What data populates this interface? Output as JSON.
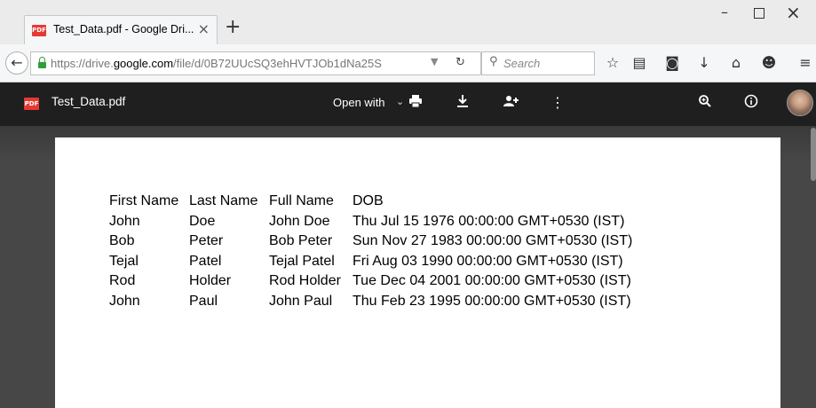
{
  "browser": {
    "tab": {
      "title": "Test_Data.pdf - Google Dri...",
      "icon": "pdf-icon",
      "close": "×"
    },
    "new_tab": "+",
    "window_controls": {
      "minimize": "–",
      "maximize": "□",
      "close": "×"
    },
    "url": {
      "prefix": "https://drive.",
      "domain": "google.com",
      "path": "/file/d/0B72UUcSQ3ehHVTJOb1dNa25S"
    },
    "search": {
      "placeholder": "Search"
    },
    "toolbar_icons": [
      "star-icon",
      "reading-list-icon",
      "pocket-icon",
      "download-icon",
      "home-icon",
      "chat-icon",
      "menu-icon"
    ]
  },
  "drive": {
    "file_name": "Test_Data.pdf",
    "open_with": "Open with",
    "pdf_badge": "PDF",
    "actions": [
      "print-icon",
      "download-icon",
      "share-icon",
      "more-icon",
      "zoom-icon",
      "info-icon"
    ]
  },
  "document": {
    "headers": [
      "First Name",
      "Last Name",
      "Full Name",
      "DOB"
    ],
    "rows": [
      [
        "John",
        "Doe",
        "John Doe",
        "Thu Jul 15 1976 00:00:00 GMT+0530 (IST)"
      ],
      [
        "Bob",
        "Peter",
        "Bob Peter",
        "Sun Nov 27 1983 00:00:00 GMT+0530 (IST)"
      ],
      [
        "Tejal",
        "Patel",
        "Tejal Patel",
        "Fri Aug 03 1990 00:00:00 GMT+0530 (IST)"
      ],
      [
        "Rod",
        "Holder",
        "Rod Holder",
        "Tue Dec 04 2001 00:00:00 GMT+0530 (IST)"
      ],
      [
        "John",
        "Paul",
        "John Paul",
        "Thu Feb 23 1995 00:00:00 GMT+0530 (IST)"
      ]
    ]
  },
  "colors": {
    "accent_pdf": "#e53935",
    "drive_header": "#1f1f1f",
    "viewer_bg": "#474747"
  }
}
